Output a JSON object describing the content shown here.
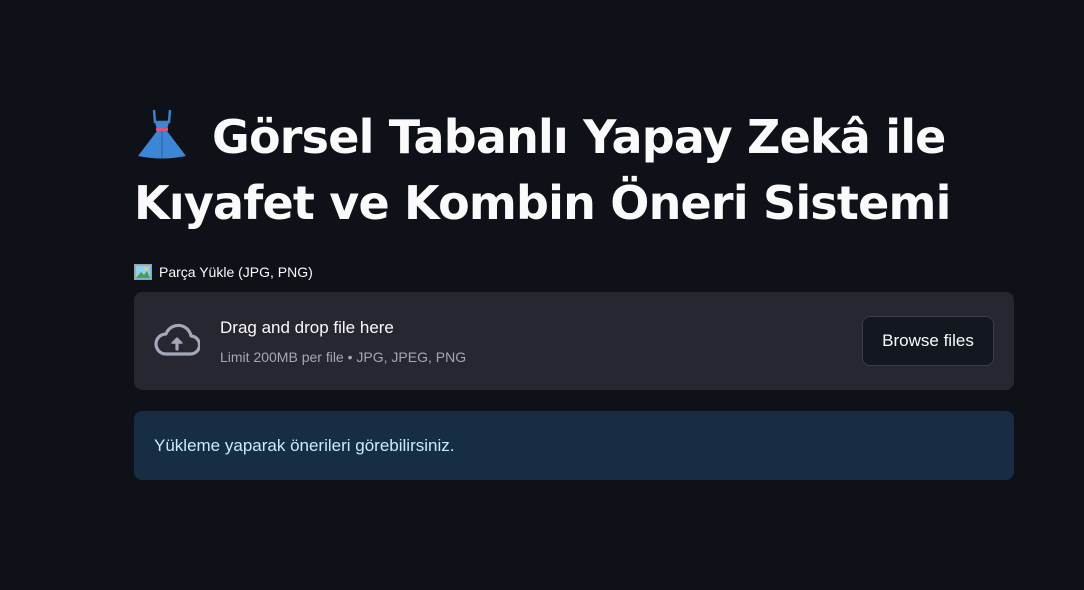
{
  "page": {
    "title": "Görsel Tabanlı Yapay Zekâ ile Kıyafet ve Kombin Öneri Sistemi",
    "title_icon": "dress-icon"
  },
  "uploader": {
    "label": "Parça Yükle (JPG, PNG)",
    "label_icon": "framed-picture-icon",
    "drop_text": "Drag and drop file here",
    "limit_text": "Limit 200MB per file • JPG, JPEG, PNG",
    "browse_label": "Browse files",
    "upload_icon": "cloud-upload-icon"
  },
  "info": {
    "message": "Yükleme yaparak önerileri görebilirsiniz."
  },
  "colors": {
    "background": "#0e1117",
    "dropzone": "#262730",
    "info_background": "#172d43",
    "info_text": "#c7ebff"
  }
}
